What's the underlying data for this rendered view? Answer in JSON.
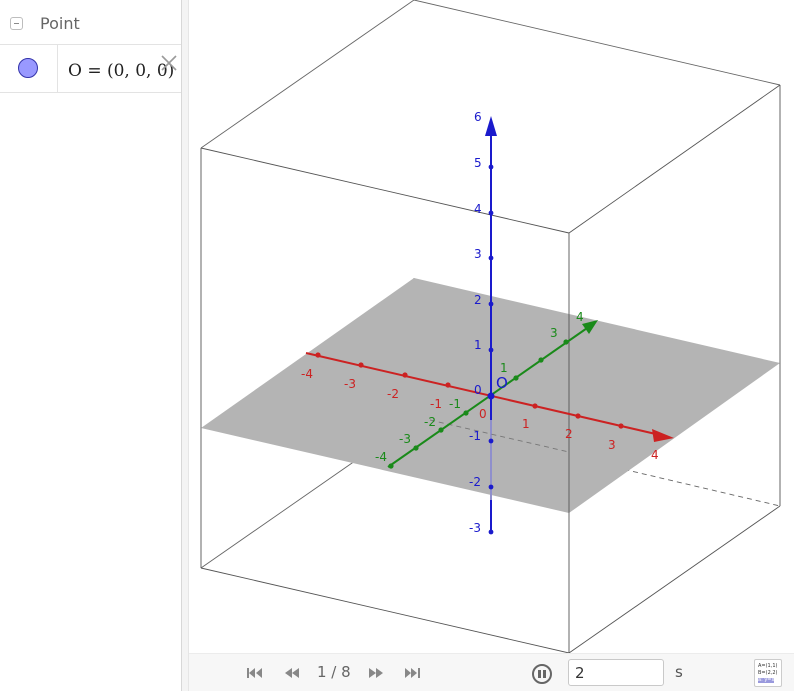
{
  "algebra": {
    "group_title": "Point",
    "objects": [
      {
        "formula": "O = (0, 0, 0)",
        "marble_color": "#9999ff"
      }
    ]
  },
  "graphics3d": {
    "point_label": "O",
    "colors": {
      "x_axis": "#cc2222",
      "y_axis": "#1a8a1a",
      "z_axis": "#1a1acc",
      "plane": "#b4b4b4",
      "box": "#555555"
    },
    "x_ticks": [
      "-4",
      "-3",
      "-2",
      "-1",
      "0",
      "1",
      "2",
      "3",
      "4"
    ],
    "y_ticks": [
      "-4",
      "-3",
      "-2",
      "-1",
      "1",
      "3",
      "4"
    ],
    "z_ticks": [
      "-3",
      "-2",
      "-1",
      "0",
      "1",
      "2",
      "3",
      "4",
      "5",
      "6"
    ]
  },
  "toolbar": {
    "slide_counter": "1 / 8",
    "speed_value": "2",
    "speed_unit": "s",
    "av_toggle_lines": [
      "A=(1,1)",
      "B=(2,2)",
      "a: y=x"
    ]
  }
}
